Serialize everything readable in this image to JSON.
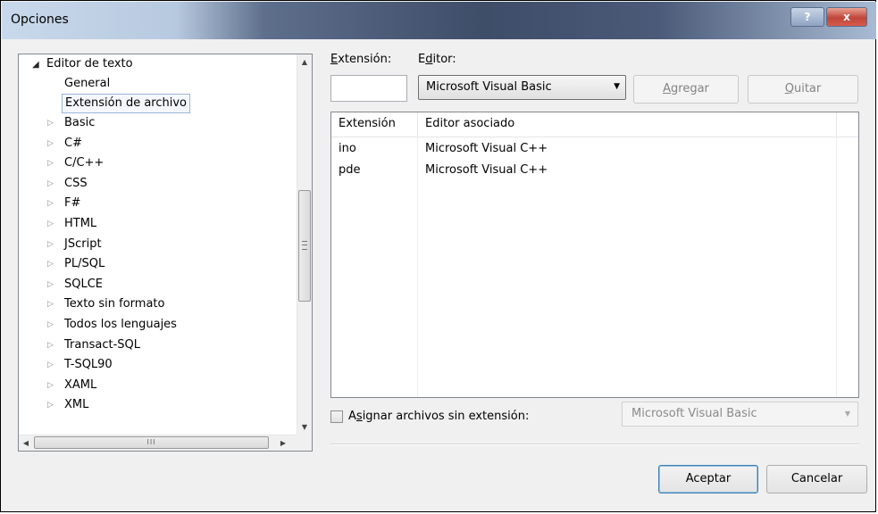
{
  "window": {
    "title": "Opciones",
    "help_glyph": "?",
    "close_glyph": "x"
  },
  "tree": {
    "root": {
      "label": "Editor de texto",
      "arrow": "◢"
    },
    "children": [
      {
        "label": "General"
      },
      {
        "label": "Extensión de archivo",
        "selected": true
      }
    ],
    "languages": [
      {
        "label": "Basic"
      },
      {
        "label": "C#"
      },
      {
        "label": "C/C++"
      },
      {
        "label": "CSS"
      },
      {
        "label": "F#"
      },
      {
        "label": "HTML"
      },
      {
        "label": "JScript"
      },
      {
        "label": "PL/SQL"
      },
      {
        "label": "SQLCE"
      },
      {
        "label": "Texto sin formato"
      },
      {
        "label": "Todos los lenguajes"
      },
      {
        "label": "Transact-SQL"
      },
      {
        "label": "T-SQL90"
      },
      {
        "label": "XAML"
      },
      {
        "label": "XML"
      }
    ],
    "collapsed_arrow": "▷",
    "hscroll_grip": "III"
  },
  "extension": {
    "label_accel": "E",
    "label_rest": "xtensión:",
    "value": ""
  },
  "editor": {
    "label_pre": "E",
    "label_accel": "d",
    "label_rest": "itor:",
    "selected": "Microsoft Visual Basic"
  },
  "buttons": {
    "add": {
      "accel": "A",
      "rest": "gregar"
    },
    "remove": {
      "accel": "Q",
      "rest": "uitar"
    },
    "ok": "Aceptar",
    "cancel": "Cancelar"
  },
  "list": {
    "columns": [
      "Extensión",
      "Editor asociado"
    ],
    "rows": [
      {
        "ext": "ino",
        "editor": "Microsoft Visual C++"
      },
      {
        "ext": "pde",
        "editor": "Microsoft Visual C++"
      }
    ]
  },
  "no_extension": {
    "label_pre": "A",
    "label_accel": "s",
    "label_rest": "ignar archivos sin extensión:",
    "checked": false,
    "combo_value": "Microsoft Visual Basic"
  }
}
